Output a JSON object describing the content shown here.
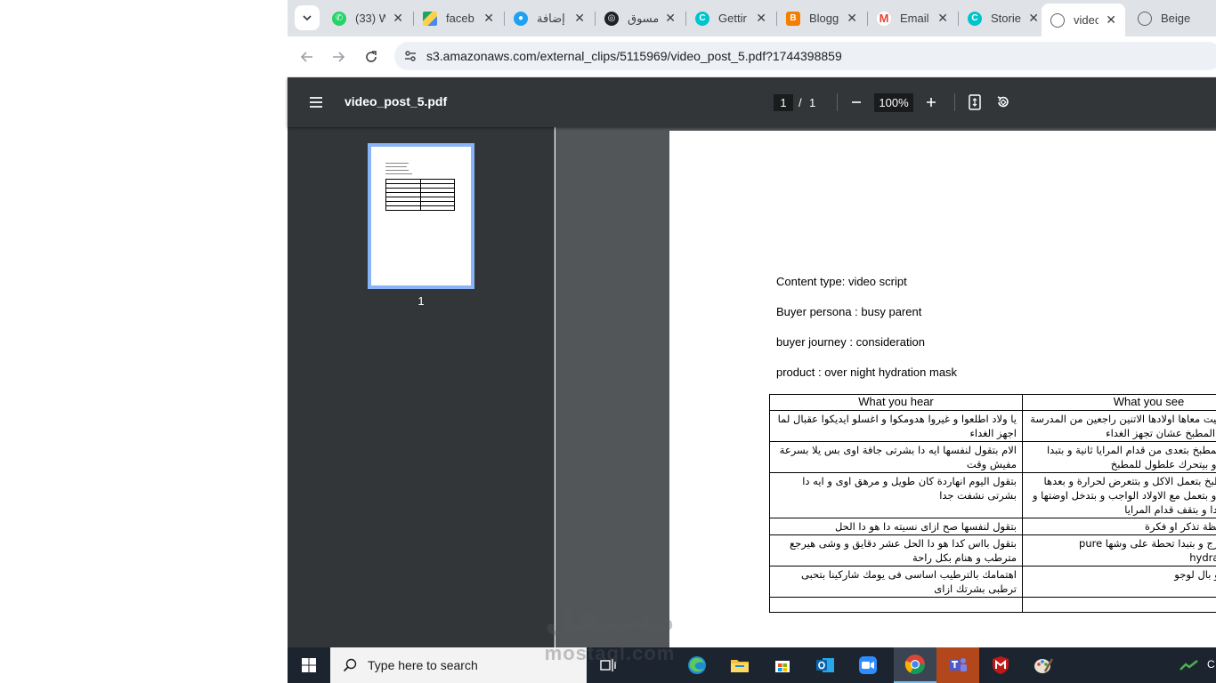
{
  "browser": {
    "tabs": [
      {
        "title": "(33) W",
        "icon": "whatsapp-icon",
        "color": "#25d366"
      },
      {
        "title": "faceb",
        "icon": "google-drive-icon",
        "color": "#1fa463"
      },
      {
        "title": "إضافة",
        "icon": "circle-app-icon",
        "color": "#1da1f2"
      },
      {
        "title": "مسوق",
        "icon": "chatgpt-icon",
        "color": "#202124"
      },
      {
        "title": "Gettir",
        "icon": "canva-icon",
        "color": "#00c4cc"
      },
      {
        "title": "Blogg",
        "icon": "blogger-icon",
        "color": "#f57d00"
      },
      {
        "title": "Email",
        "icon": "gmail-icon",
        "color": "#ea4335"
      },
      {
        "title": "Storie",
        "icon": "canva-icon",
        "color": "#00c4cc"
      },
      {
        "title": "video",
        "icon": "globe-icon",
        "color": "#5f6368",
        "active": true
      },
      {
        "title": "Beige",
        "icon": "globe-icon",
        "color": "#5f6368"
      }
    ],
    "url": "s3.amazonaws.com/external_clips/5115969/video_post_5.pdf?1744398859"
  },
  "pdf": {
    "filename": "video_post_5.pdf",
    "current_page": "1",
    "page_separator": "/",
    "total_pages": "1",
    "zoom": "100%",
    "thumbnail_label": "1"
  },
  "document": {
    "content_type": "Content type: video script",
    "buyer_persona": "Buyer persona : busy parent",
    "buyer_journey": "buyer journey : consideration",
    "product": "product : over night hydration mask",
    "table": {
      "headers": [
        "What you hear",
        "What you see"
      ],
      "rows": [
        {
          "hear": "يا ولاد اطلعوا و غيروا هدومكوا و اغسلو ايديكوا عقبال لما اجهز الغداء",
          "see": "تدخل الام البيت معاها اولادها الاتنين راجعين من المدرسة و بتبدا تدخل المطبخ عشان تجهز الغداء"
        },
        {
          "hear": "الام بتقول لنفسها ايه دا بشرتى جافة اوى بس يلا بسرعة مفيش وقت",
          "see": "الام بتدخل المطبخ بتعدى من قدام المرايا ثانية و بتبدا تلمس وشها و بيتحرك علطول للمطبخ"
        },
        {
          "hear": "بتقول اليوم انهاردة كان طويل و مرهق اوى و ايه دا بشرتى نشفت جدا",
          "see": "الام في المطبخ بتعمل الاكل و بتتعرض لحرارة و بعدها بتروق البيت و بتعمل مع الاولاد الواجب و بتدخل اوضتها و هى منهكة جدا و بتقف قدام المرايا"
        },
        {
          "hear": "بتقول لنفسها صح ازاى نسيته دا هو دا الحل",
          "see": "بيجى للام لحظة تذكر او فكرة"
        },
        {
          "hear": "بتقول بااس كدا هو دا الحل عشر دقايق و وشى هيرجع مترطب و هنام بكل راحة",
          "see": "تطلع من الدرج و بتبدا تحطة على وشها pure hydration mask"
        },
        {
          "hear": "اهتمامك بالترطيب اساسى فى يومك شاركينا بتحبى ترطبى بشرتك ازاى",
          "see": "بيقفل الفيديو بال لوجو"
        },
        {
          "hear": "",
          "see": ""
        }
      ]
    }
  },
  "taskbar": {
    "search_placeholder": "Type here to search",
    "apps": [
      "task-view-icon",
      "edge-icon",
      "file-explorer-icon",
      "store-icon",
      "outlook-icon",
      "zoom-icon",
      "chrome-icon",
      "teams-icon",
      "mcafee-icon",
      "paint-icon"
    ],
    "tray_text": "C"
  },
  "watermark": {
    "arabic": "مستقل",
    "latin": "mostaql.com"
  }
}
